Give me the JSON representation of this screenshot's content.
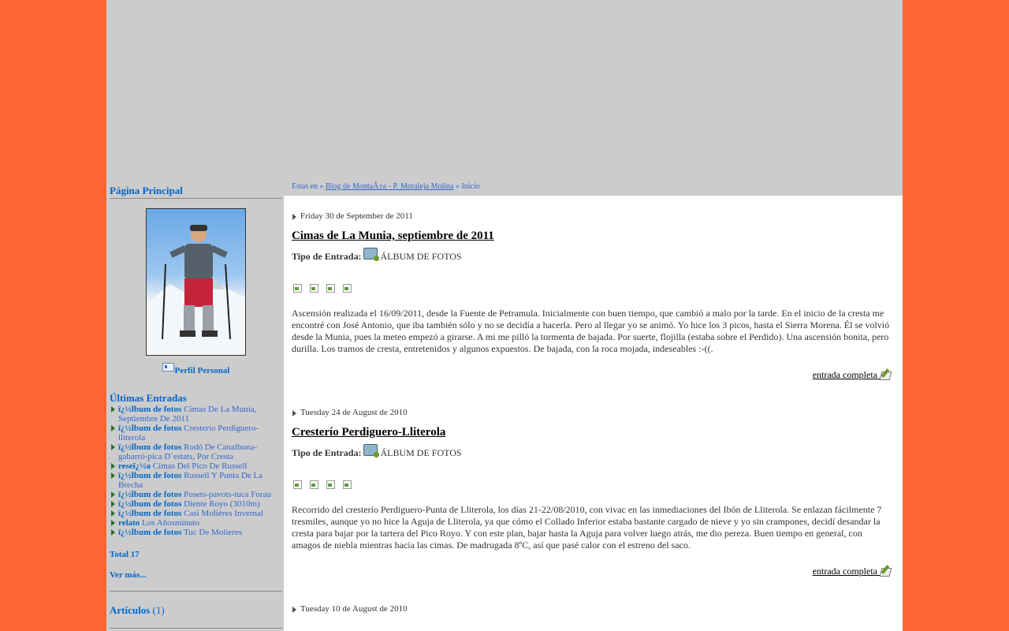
{
  "sidebar": {
    "main_title": "Página Principal",
    "profile_link": "Perfil Personal",
    "latest_title": "Últimas Entradas",
    "entries": [
      {
        "kind": "ï¿½lbum de fotos",
        "title": "Cimas De La Munia, Septiembre De 2011"
      },
      {
        "kind": "ï¿½lbum de fotos",
        "title": "Cresterío Perdiguero-lliterola"
      },
      {
        "kind": "ï¿½lbum de fotos",
        "title": "Rodó De Canalbona-gabarró-pica D´estats, Por Cresta"
      },
      {
        "kind": "reseï¿½a",
        "title": "Cimas Del Pico De Russell"
      },
      {
        "kind": "ï¿½lbum de fotos",
        "title": "Russell Y Punta De La Brecha"
      },
      {
        "kind": "ï¿½lbum de fotos",
        "title": "Posets-pavots-tuca Forau"
      },
      {
        "kind": "ï¿½lbum de fotos",
        "title": "Diente Royo (3010m)"
      },
      {
        "kind": "ï¿½lbum de fotos",
        "title": "Casi Molières Invernal"
      },
      {
        "kind": "relato",
        "title": "Los Añosminuto"
      },
      {
        "kind": "ï¿½lbum de fotos",
        "title": "Tuc De Molieres"
      }
    ],
    "total": "Total 17",
    "more": "Ver más...",
    "articles_label": "Artículos",
    "articles_count": "(1)"
  },
  "breadcrumb": {
    "prefix": "Estas en »",
    "blog_link": "Blog de MontaÃ±a - P. Moraleja Molina",
    "sep": "»",
    "current": "Inicio"
  },
  "posts": [
    {
      "date": "Friday 30 de September de 2011",
      "title": "Cimas de La Munia, septiembre de 2011",
      "type_label": "Tipo de Entrada:",
      "type_value": "ÁLBUM DE FOTOS",
      "body": "Ascensión realizada el 16/09/2011, desde la Fuente de Petramula. Inicialmente con buen tiempo, que cambió a malo por la tarde. En el inicio de la cresta me encontré con José Antonio, que iba también sólo y no se decidía a hacerla. Pero al llegar yo se animó. Yo hice los 3 picos, hasta el Sierra Morena. Él se volvió desde la Munia, pues la meteo empezó a girarse. A mi me pilló la tormenta de bajada. Por suerte, flojilla (estaba sobre el Perdido). Una ascensión bonita, pero durilla. Los tramos de cresta, entretenidos y algunos expuestos. De bajada, con la roca mojada, indeseables :-((.",
      "more_link": "entrada completa"
    },
    {
      "date": "Tuesday 24 de August de 2010",
      "title": "Cresterío Perdiguero-Lliterola",
      "type_label": "Tipo de Entrada:",
      "type_value": "ÁLBUM DE FOTOS",
      "body": "Recorrido del cresterío Perdiguero-Punta de Lliterola, los días 21-22/08/2010, con vivac en las inmediaciones del Ibón de Lliterola. Se enlazan fácilmente 7 tresmiles, aunque yo no hice la Aguja de Lliterola, ya que cómo el Collado Inferior estaba bastante cargado de nieve y yo sin crampones, decidí desandar la cresta para bajar por la tartera del Pico Royo. Y con este plan, bajar hasta la Aguja para volver luego atrás, me dio pereza. Buen tiempo en general, con amagos de niebla mientras hacía las cimas. De madrugada 8ºC, así que pasé calor con el estreno del saco.",
      "more_link": "entrada completa"
    },
    {
      "date": "Tuesday 10 de August de 2010"
    }
  ],
  "colors": {
    "background": "#ff6633",
    "page": "#cccccc",
    "link": "#0066cc"
  }
}
